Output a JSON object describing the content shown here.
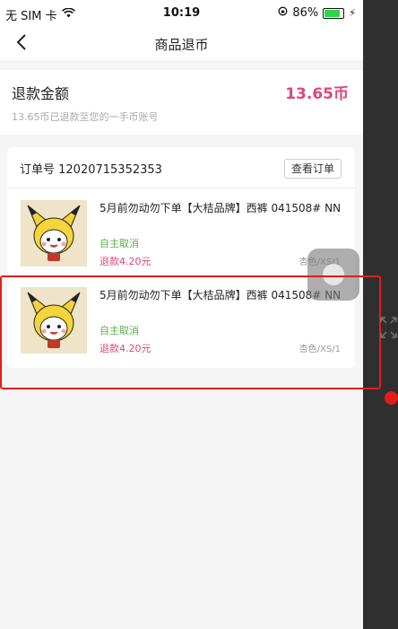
{
  "status_bar": {
    "carrier": "无 SIM 卡",
    "time": "10:19",
    "battery_percent": "86%",
    "battery_level": 0.86,
    "battery_color": "#2bd44b"
  },
  "nav": {
    "title": "商品退币",
    "back_icon": "chevron-left-icon"
  },
  "refund": {
    "label": "退款金额",
    "amount": "13.65币",
    "note": "13.65币已退款至您的一手币账号",
    "amount_color": "#e0457b"
  },
  "order": {
    "number": "订单号 12020715352353",
    "view_button": "查看订单",
    "items": [
      {
        "title": "5月前勿动勿下单【大桔品牌】西裤  041508#  NN",
        "status": "自主取消",
        "refund": "退款4.20元",
        "spec": "杏色/XS/1"
      },
      {
        "title": "5月前勿动勿下单【大桔品牌】西裤  041508#  NN",
        "status": "自主取消",
        "refund": "退款4.20元",
        "spec": "杏色/XS/1"
      }
    ]
  },
  "colors": {
    "accent_pink": "#e0457b",
    "status_green": "#5fae4a",
    "highlight_red": "#e51c1c"
  }
}
